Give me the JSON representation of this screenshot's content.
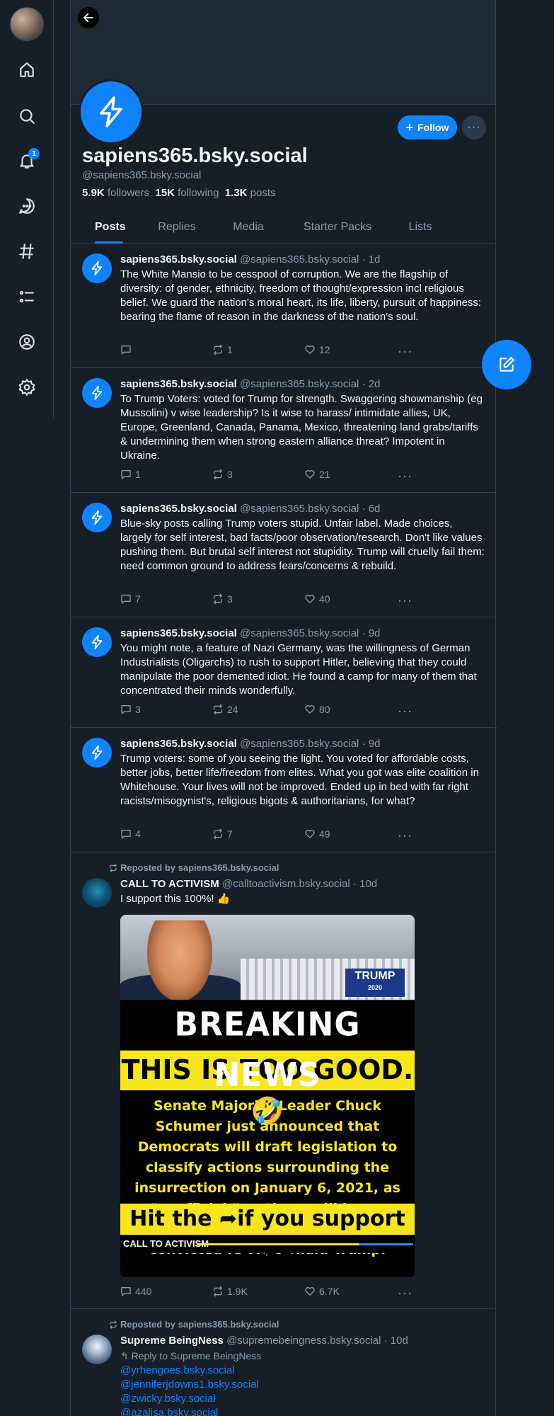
{
  "nav": {
    "notifications_count": "1",
    "icons": [
      "home-icon",
      "search-icon",
      "bell-icon",
      "chat-icon",
      "hashtag-icon",
      "list-icon",
      "profile-icon",
      "gear-icon"
    ]
  },
  "profile": {
    "display_name": "sapiens365.bsky.social",
    "handle": "@sapiens365.bsky.social",
    "followers_count": "5.9K",
    "followers_label": "followers",
    "following_count": "15K",
    "following_label": "following",
    "posts_count": "1.3K",
    "posts_label": "posts",
    "follow_label": "Follow",
    "more_label": "···"
  },
  "tabs": [
    "Posts",
    "Replies",
    "Media",
    "Starter Packs",
    "Lists"
  ],
  "posts": [
    {
      "name": "sapiens365.bsky.social",
      "meta": "@sapiens365.bsky.social · 1d",
      "text": "The White Mansio to be  cesspool of corruption. We are the flagship of diversity: of gender,  ethnicity, freedom of thought/expression incl religious belief. We guard the nation's moral heart, its life, liberty, pursuit of happiness: bearing  the flame of reason in the darkness of the nation's soul.",
      "replies": "",
      "reposts": "1",
      "likes": "12"
    },
    {
      "name": "sapiens365.bsky.social",
      "meta": "@sapiens365.bsky.social · 2d",
      "text": "To Trump Voters: voted for Trump for strength. Swaggering showmanship (eg Mussolini) v wise leadership? Is it wise to harass/ intimidate allies, UK, Europe, Greenland, Canada, Panama, Mexico, threatening land grabs/tariffs & undermining them when strong eastern alliance threat? Impotent in Ukraine.",
      "replies": "1",
      "reposts": "3",
      "likes": "21"
    },
    {
      "name": "sapiens365.bsky.social",
      "meta": "@sapiens365.bsky.social · 6d",
      "text": " Blue-sky posts calling Trump voters stupid. Unfair label. Made choices, largely for self interest, bad facts/poor observation/research. Don't like values pushing them. But brutal self interest not stupidity. Trump will cruelly fail them: need common ground to address fears/concerns & rebuild.",
      "replies": "7",
      "reposts": "3",
      "likes": "40"
    },
    {
      "name": "sapiens365.bsky.social",
      "meta": "@sapiens365.bsky.social · 9d",
      "text": "You might note, a feature of Nazi Germany, was the willingness of German Industrialists (Oligarchs) to rush to support Hitler, believing that they could manipulate the poor demented idiot. He found a camp for many of them that concentrated their minds wonderfully.",
      "replies": "3",
      "reposts": "24",
      "likes": "80"
    },
    {
      "name": "sapiens365.bsky.social",
      "meta": "@sapiens365.bsky.social · 9d",
      "text": "Trump voters: some of you seeing the light. You voted for affordable costs, better jobs, better life/freedom from elites. What you got was elite coalition in Whitehouse. Your lives will not be improved. Ended up in bed with far right racists/misogynist's, religious bigots & authoritarians, for what?",
      "replies": "4",
      "reposts": "7",
      "likes": "49"
    }
  ],
  "repost1": {
    "reposted_by": "Reposted by sapiens365.bsky.social",
    "name": "CALL TO ACTIVISM",
    "meta": "@calltoactivism.bsky.social · 10d",
    "text": "I support this 100%! 👍",
    "image": {
      "trump_sign": "TRUMP",
      "trump_year": "2020",
      "breaking": "BREAKING NEWS",
      "too_good": "THIS IS TOO GOOD. 🤣",
      "body": "Senate Majority Leader Chuck Schumer just announced that Democrats will draft legislation to classify actions surrounding the insurrection on January 6, 2021, as \"unofficial,\" so there will be no immunity from prosecution for convicted felon, Donald Trump.",
      "hit_before": "Hit the",
      "hit_after": "if you support this!",
      "footer": "CALL TO ACTIVISM"
    },
    "replies": "440",
    "reposts": "1.9K",
    "likes": "6.7K"
  },
  "repost2": {
    "reposted_by": "Reposted by sapiens365.bsky.social",
    "name": "Supreme BeingNess",
    "meta": "@supremebeingness.bsky.social · 10d",
    "reply_to": "Reply to Supreme BeingNess",
    "mentions": [
      "@yrhengoes.bsky.social",
      "@jenniferjdowns1.bsky.social",
      "@zwicky.bsky.social",
      "@azalisa.bsky.social"
    ]
  }
}
